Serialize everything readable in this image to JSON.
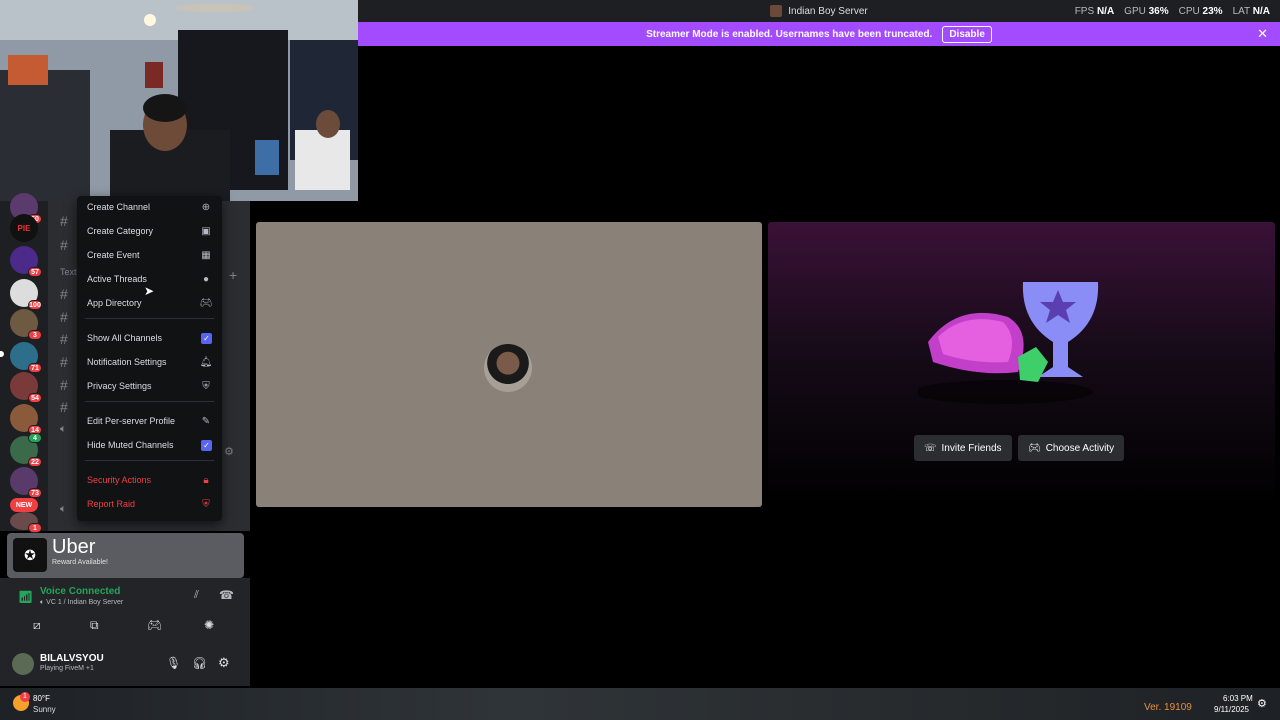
{
  "window": {
    "server_name": "Indian Boy Server",
    "perf": [
      {
        "label": "FPS",
        "value": "N/A"
      },
      {
        "label": "GPU",
        "value": "36%"
      },
      {
        "label": "CPU",
        "value": "23%"
      },
      {
        "label": "LAT",
        "value": "N/A"
      }
    ]
  },
  "banner": {
    "text": "Streamer Mode is enabled. Usernames have been truncated.",
    "button": "Disable"
  },
  "rail": {
    "badges": [
      "50",
      "57",
      "100",
      "3",
      "71",
      "2",
      "54",
      "14",
      "4",
      "22",
      "73",
      "NEW",
      "1"
    ],
    "server_label": "PIE"
  },
  "channels": {
    "category_label": "Text"
  },
  "context_menu": {
    "items": [
      {
        "label": "Create Channel"
      },
      {
        "label": "Create Category"
      },
      {
        "label": "Create Event"
      },
      {
        "label": "Active Threads"
      },
      {
        "label": "App Directory"
      },
      {
        "label": "Show All Channels",
        "checked": true
      },
      {
        "label": "Notification Settings"
      },
      {
        "label": "Privacy Settings"
      },
      {
        "label": "Edit Per-server Profile"
      },
      {
        "label": "Hide Muted Channels",
        "checked": true
      },
      {
        "label": "Security Actions",
        "danger": true
      },
      {
        "label": "Report Raid",
        "danger": true
      }
    ]
  },
  "uber": {
    "title": "Uber",
    "subtitle": "Reward Available!"
  },
  "voice": {
    "status": "Voice Connected",
    "channel": "VC 1 / Indian Boy Server"
  },
  "user": {
    "name": "BILALVSYOU",
    "activity": "Playing FiveM +1"
  },
  "activity": {
    "invite_label": "Invite Friends",
    "choose_label": "Choose Activity"
  },
  "taskbar": {
    "weather_temp": "80°F",
    "weather_desc": "Sunny",
    "weather_badge": "1",
    "version": "Ver. 19109",
    "time": "6:03 PM",
    "date": "9/11/2025"
  },
  "colors": {
    "banner": "#a24bff",
    "blurple": "#5865f2",
    "danger": "#f23f43",
    "voice_green": "#23a55a"
  }
}
